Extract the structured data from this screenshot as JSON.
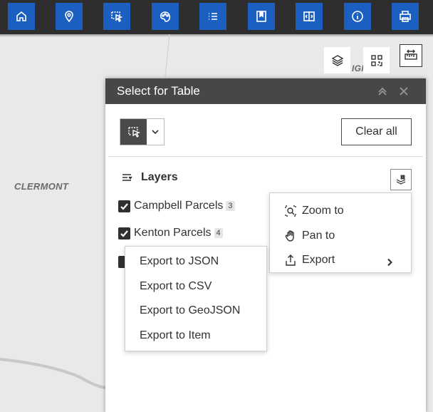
{
  "toolbar": {
    "buttons": [
      {
        "id": "home",
        "icon": "home-icon"
      },
      {
        "id": "locate",
        "icon": "location-pin-icon"
      },
      {
        "id": "select",
        "icon": "select-pointer-icon"
      },
      {
        "id": "basemap",
        "icon": "palette-icon"
      },
      {
        "id": "list",
        "icon": "list-icon"
      },
      {
        "id": "bookmark",
        "icon": "bookmark-icon"
      },
      {
        "id": "compare",
        "icon": "compare-icon"
      },
      {
        "id": "info",
        "icon": "info-icon"
      },
      {
        "id": "print",
        "icon": "print-icon"
      }
    ],
    "button_color": "#1b5fc0",
    "background": "#2e2e2e"
  },
  "map": {
    "labels": {
      "clermont": "CLERMONT",
      "partial": "IGH"
    }
  },
  "panel": {
    "title": "Select for Table",
    "header_color": "#474747",
    "clear_label": "Clear all",
    "layers_title": "Layers",
    "layers": [
      {
        "name": "Campbell Parcels",
        "count": "3",
        "checked": true
      },
      {
        "name": "Kenton Parcels",
        "count": "4",
        "checked": true
      }
    ]
  },
  "context_menu": {
    "items": [
      {
        "label": "Zoom to",
        "icon": "zoom-to-icon"
      },
      {
        "label": "Pan to",
        "icon": "pan-hand-icon"
      },
      {
        "label": "Export",
        "icon": "export-icon",
        "has_submenu": true
      }
    ]
  },
  "export_menu": {
    "items": [
      {
        "label": "Export to JSON"
      },
      {
        "label": "Export to CSV"
      },
      {
        "label": "Export to GeoJSON"
      },
      {
        "label": "Export to Item"
      }
    ]
  }
}
